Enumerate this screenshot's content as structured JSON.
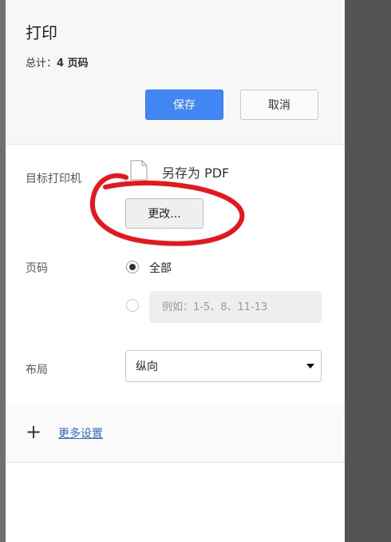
{
  "header": {
    "title": "打印",
    "total_prefix": "总计：",
    "total_value": "4 页码",
    "save_label": "保存",
    "cancel_label": "取消"
  },
  "destination": {
    "label": "目标打印机",
    "name": "另存为 PDF",
    "change_label": "更改..."
  },
  "pages": {
    "label": "页码",
    "all_label": "全部",
    "custom_placeholder": "例如：1-5、8、11-13"
  },
  "layout": {
    "label": "布局",
    "selected": "纵向"
  },
  "more": {
    "link_label": "更多设置"
  },
  "colors": {
    "primary_button": "#4285f4",
    "link": "#3367d6",
    "annotation_red": "#e8161b"
  },
  "icons": {
    "destination": "pdf-file-icon",
    "more": "plus-icon",
    "dropdown": "caret-down-icon"
  }
}
